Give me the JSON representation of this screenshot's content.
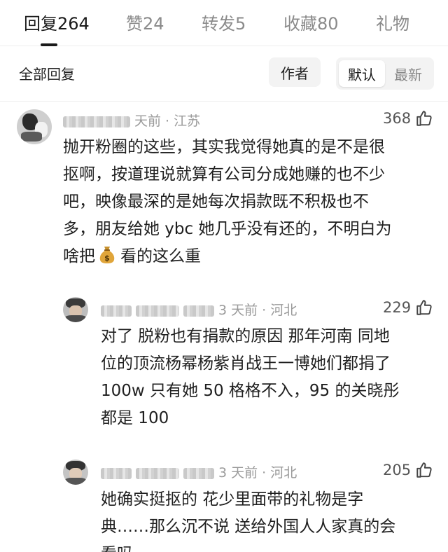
{
  "tabs": [
    {
      "label": "回复264",
      "active": true
    },
    {
      "label": "赞24",
      "active": false
    },
    {
      "label": "转发5",
      "active": false
    },
    {
      "label": "收藏80",
      "active": false
    },
    {
      "label": "礼物",
      "active": false
    }
  ],
  "filter": {
    "label": "全部回复",
    "author_button": "作者",
    "sort_options": [
      "默认",
      "最新"
    ],
    "selected_sort": "默认"
  },
  "comments": [
    {
      "meta": "天前 · 江苏",
      "likes": "368",
      "lines": [
        "抛开粉圈的这些，其实我觉得她真的是不是很",
        "抠啊，按道理说就算有公司分成她赚的也不少",
        "吧，映像最深的是她每次捐款既不积极也不",
        "多，朋友给她 ybc 她几乎没有还的，不明白为"
      ],
      "last_prefix": "啥把",
      "last_suffix": "看的这么重",
      "emoji": "money-bag"
    },
    {
      "meta": "3 天前 · 河北",
      "likes": "229",
      "lines": [
        "对了 脱粉也有捐款的原因 那年河南 同地",
        "位的顶流杨幂杨紫肖战王一博她们都捐了",
        "100w 只有她 50 格格不入，95 的关晓彤",
        "都是 100"
      ]
    },
    {
      "meta": "3 天前 · 河北",
      "likes": "205",
      "lines": [
        "她确实挺抠的 花少里面带的礼物是字",
        "典……那么沉不说 送给外国人人家真的会",
        "看吗"
      ]
    }
  ],
  "colors": {
    "text_primary": "#1f1f1f",
    "text_secondary": "#9a9a9a",
    "divider": "#eeeeee",
    "button_bg": "#f3f3f3"
  }
}
